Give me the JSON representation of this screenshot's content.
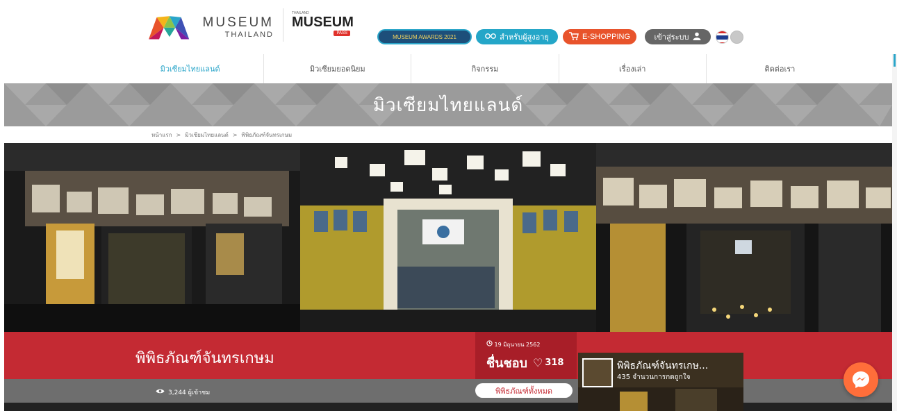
{
  "logo": {
    "line1": "MUSEUM",
    "line2": "THAILAND"
  },
  "pass_logo": {
    "top": "THAILAND",
    "main": "MUSEUM",
    "tag": "PASS"
  },
  "header_buttons": {
    "awards": "MUSEUM AWARDS 2021",
    "elder": "สำหรับผู้สูงอายุ",
    "shop": "E-SHOPPING",
    "login": "เข้าสู่ระบบ"
  },
  "nav": [
    "มิวเซียมไทยแลนด์",
    "มิวเซียมยอดนิยม",
    "กิจกรรม",
    "เรื่องเล่า",
    "ติดต่อเรา"
  ],
  "banner": {
    "title": "มิวเซียมไทยแลนด์"
  },
  "breadcrumb": [
    "หน้าแรก",
    ">",
    "มิวเซียมไทยแลนด์",
    ">",
    "พิพิธภัณฑ์จันทรเกษม"
  ],
  "museum": {
    "name": "พิพิธภัณฑ์จันทรเกษม",
    "date": "19 มิถุนายน 2562",
    "likes_label": "ชื่นชอบ",
    "likes_count": "318",
    "views": "3,244 ผู้เข้าชม",
    "all_button": "พิพิธภัณฑ์ทั้งหมด"
  },
  "fb_widget": {
    "name": "พิพิธภัณฑ์จันทรเกษ...",
    "sub": "435 จำนวนการกดถูกใจ"
  },
  "icons": {
    "elder": "glasses-icon",
    "shop": "cart-icon",
    "login": "user-icon",
    "views": "eye-icon",
    "clock": "clock-icon",
    "heart": "heart-icon",
    "messenger": "messenger-icon"
  },
  "colors": {
    "accent": "#2aa5c9",
    "red": "#c42a33",
    "orange": "#e8532b",
    "gray": "#6e6e6e"
  }
}
